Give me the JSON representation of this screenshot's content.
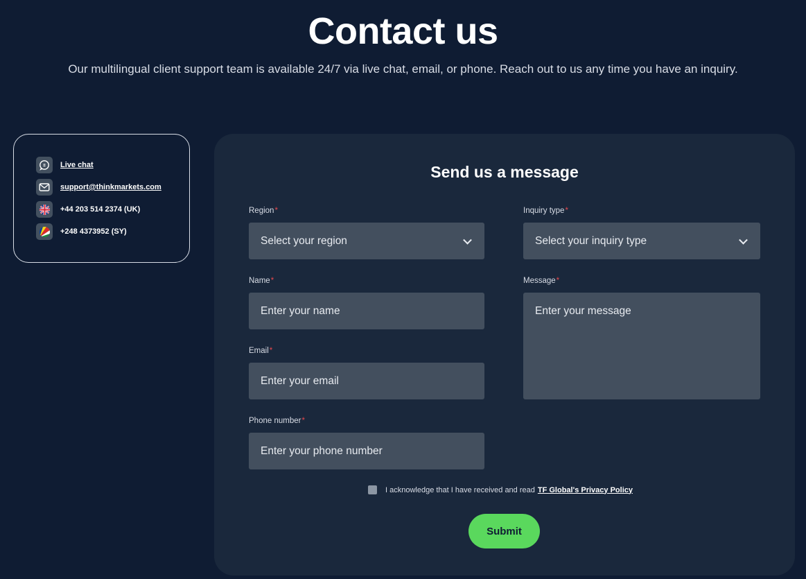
{
  "header": {
    "title": "Contact us",
    "subtitle": "Our multilingual client support team is available 24/7 via live chat, email, or phone. Reach out to us any time you have an inquiry."
  },
  "contact": {
    "live_chat": "Live chat",
    "email": "support@thinkmarkets.com",
    "phone_uk": "+44 203 514 2374 (UK)",
    "phone_sy": "+248 4373952 (SY)"
  },
  "form": {
    "title": "Send us a message",
    "region": {
      "label": "Region",
      "placeholder": "Select your region"
    },
    "inquiry": {
      "label": "Inquiry type",
      "placeholder": "Select your inquiry type"
    },
    "name": {
      "label": "Name",
      "placeholder": "Enter your name"
    },
    "message": {
      "label": "Message",
      "placeholder": "Enter your message"
    },
    "email": {
      "label": "Email",
      "placeholder": "Enter your email"
    },
    "phone": {
      "label": "Phone number",
      "placeholder": "Enter your phone number"
    },
    "required_mark": "*",
    "acknowledge_text": "I acknowledge that I have received and read",
    "acknowledge_link": "TF Global's Privacy Policy",
    "submit_label": "Submit"
  },
  "colors": {
    "background": "#0f1c33",
    "card": "#1a283c",
    "field": "#434f5e",
    "accent": "#5ad85d",
    "required": "#e5484d"
  }
}
